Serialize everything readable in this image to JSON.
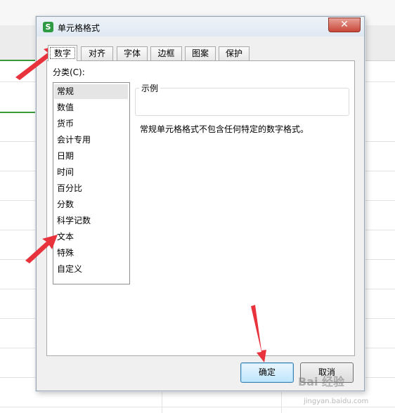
{
  "dialog": {
    "title": "单元格格式",
    "app_icon_letter": "S",
    "close_glyph": "✕"
  },
  "tabs": [
    {
      "label": "数字",
      "active": true
    },
    {
      "label": "对齐",
      "active": false
    },
    {
      "label": "字体",
      "active": false
    },
    {
      "label": "边框",
      "active": false
    },
    {
      "label": "图案",
      "active": false
    },
    {
      "label": "保护",
      "active": false
    }
  ],
  "category": {
    "label": "分类(C):",
    "items": [
      "常规",
      "数值",
      "货币",
      "会计专用",
      "日期",
      "时间",
      "百分比",
      "分数",
      "科学记数",
      "文本",
      "特殊",
      "自定义"
    ],
    "selected": "常规"
  },
  "sample": {
    "legend": "示例"
  },
  "description": "常规单元格格式不包含任何特定的数字格式。",
  "buttons": {
    "ok": "确定",
    "cancel": "取消"
  },
  "watermark": {
    "main": "Bai 经验",
    "sub": "jingyan.baidu.com"
  },
  "colors": {
    "arrow": "#e8323c",
    "accent_green": "#3a9a3a",
    "selected_item": "#e5e5e5"
  }
}
